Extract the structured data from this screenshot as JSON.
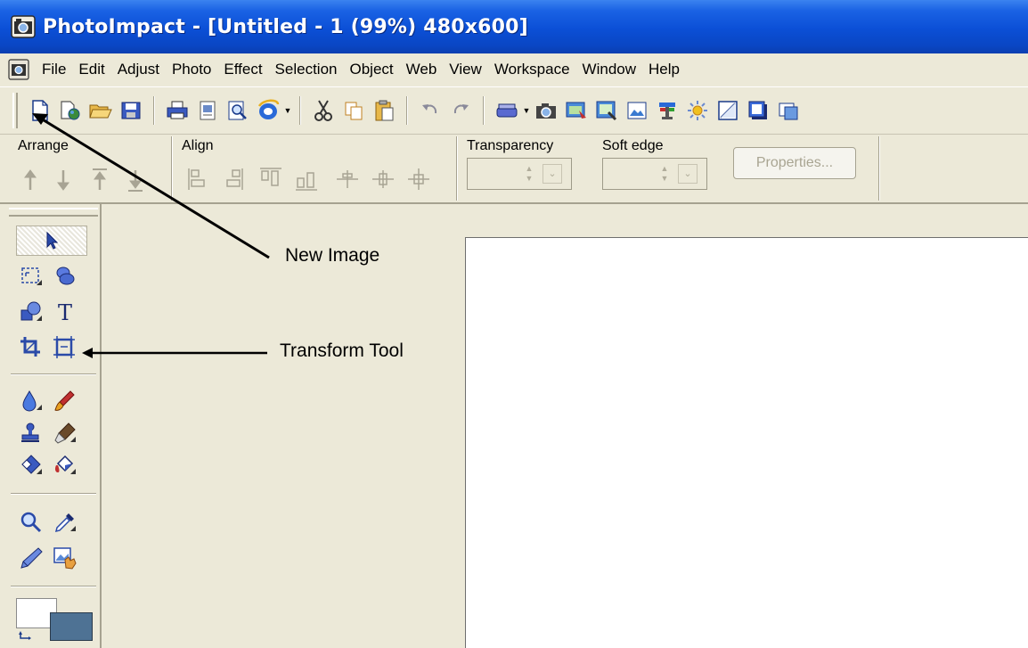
{
  "window": {
    "title": "PhotoImpact - [Untitled - 1 (99%) 480x600]",
    "title_bar_color": "#0b4fd6"
  },
  "menu": {
    "items": [
      "File",
      "Edit",
      "Adjust",
      "Photo",
      "Effect",
      "Selection",
      "Object",
      "Web",
      "View",
      "Workspace",
      "Window",
      "Help"
    ]
  },
  "toolbar": {
    "icons": [
      "new-image-icon",
      "open-web-icon",
      "open-folder-icon",
      "save-icon",
      "print-icon",
      "print-preview-icon",
      "preview-icon",
      "internet-explorer-icon",
      "cut-icon",
      "copy-icon",
      "paste-icon",
      "undo-icon",
      "redo-icon",
      "scan-icon",
      "camera-icon",
      "capture-icon",
      "image-effect-icon",
      "image-icon",
      "balance-icon",
      "brightness-icon",
      "frame-icon",
      "shadow-icon",
      "web-icon"
    ]
  },
  "attribute_bar": {
    "arrange_label": "Arrange",
    "align_label": "Align",
    "transparency_label": "Transparency",
    "soft_edge_label": "Soft edge",
    "properties_label": "Properties..."
  },
  "annotations": {
    "new_image": "New Image",
    "transform_tool": "Transform Tool"
  },
  "tool_panel": {
    "tools": [
      "pick-tool",
      "selection-tool",
      "object-paint-tool",
      "path-tool",
      "text-tool",
      "crop-tool",
      "transform-tool",
      "retouch-tool",
      "paint-tool",
      "clone-tool",
      "eraser-tool",
      "fill-tool",
      "zoom-tool",
      "eyedropper-tool",
      "pen-tool",
      "stamp-tool"
    ],
    "foreground_color": "#ffffff",
    "background_color": "#4e7294"
  }
}
